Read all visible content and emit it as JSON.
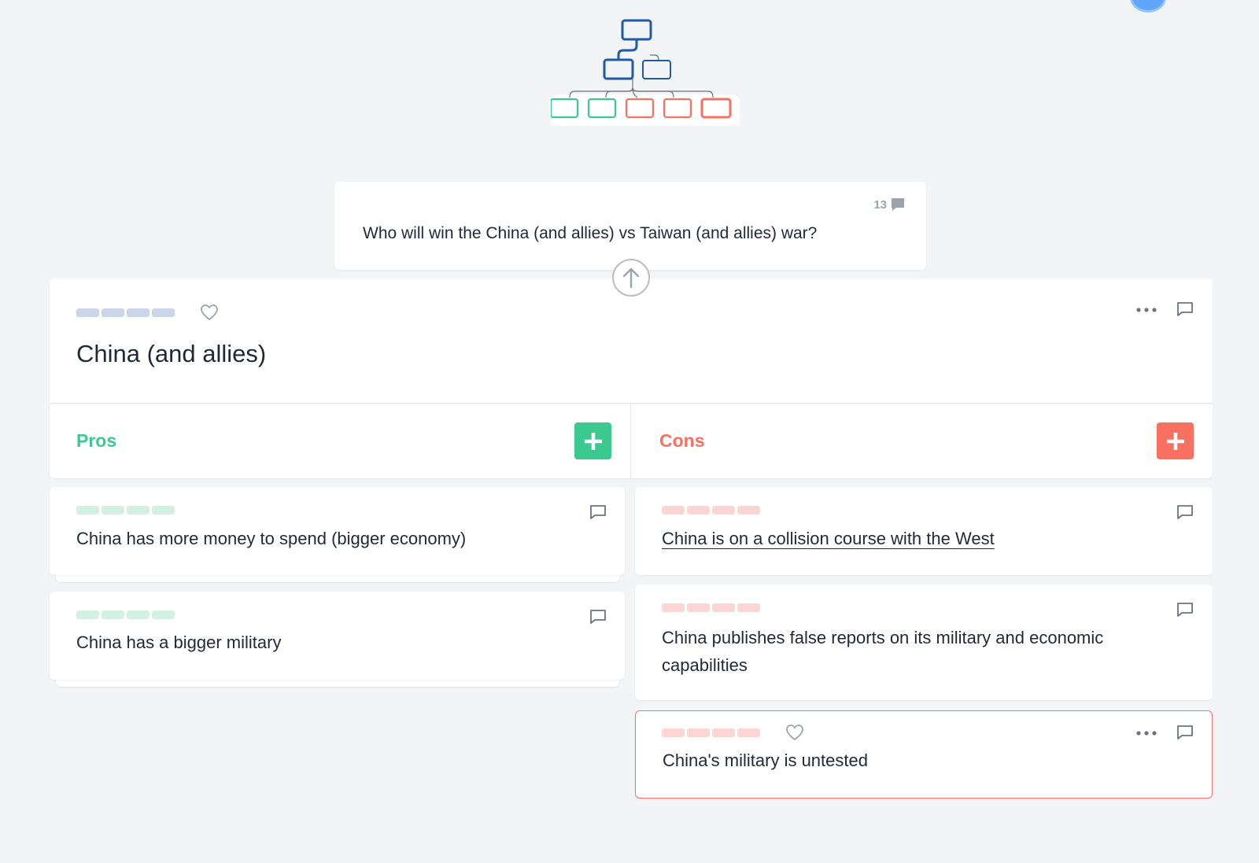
{
  "parent": {
    "text": "Who will win the China (and allies) vs Taiwan (and allies) war?",
    "comment_count": "13"
  },
  "claim": {
    "title": "China (and allies)"
  },
  "columns": {
    "pros_label": "Pros",
    "cons_label": "Cons"
  },
  "pros": [
    {
      "text": "China has more money to spend (bigger economy)"
    },
    {
      "text": "China has a bigger military"
    }
  ],
  "cons": [
    {
      "text": "China is on a collision course with the West"
    },
    {
      "text": "China publishes false reports on its military and economic capabilities"
    },
    {
      "text": "China's military is untested"
    }
  ],
  "colors": {
    "pro": "#3cc98f",
    "con": "#f87060",
    "pro_bar": "#d1f2e3",
    "con_bar": "#fdd5d2",
    "neutral_bar": "#c8d6e8"
  },
  "icons": [
    "tree-logo",
    "comment-icon",
    "heart-icon",
    "more-icon",
    "arrow-up-icon",
    "plus-icon"
  ]
}
